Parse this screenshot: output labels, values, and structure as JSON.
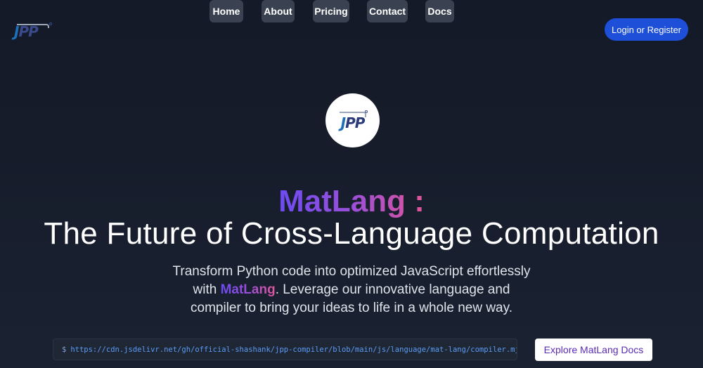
{
  "logo": {
    "part1": "J",
    "part2": "PP"
  },
  "nav": {
    "items": [
      {
        "label": "Home"
      },
      {
        "label": "About"
      },
      {
        "label": "Pricing"
      },
      {
        "label": "Contact"
      },
      {
        "label": "Docs"
      }
    ]
  },
  "header": {
    "login_label": "Login or Register"
  },
  "hero": {
    "brand": "MatLang :",
    "title": "The Future of Cross-Language Computation",
    "description": {
      "before": "Transform Python code into optimized JavaScript effortlessly with ",
      "highlight": "MatLang",
      "after": ". Leverage our innovative language and compiler to bring your ideas to life in a whole new way."
    },
    "cdn": {
      "prompt": "$",
      "url": "https://cdn.jsdelivr.net/gh/official-shashank/jpp-compiler/blob/main/js/language/mat-lang/compiler.mjs"
    },
    "docs_button": "Explore MatLang Docs"
  },
  "colors": {
    "accent_blue": "#1d4fd8",
    "gradient_start": "#6c4bf2",
    "gradient_end": "#e0559a",
    "background": "#161c2a"
  }
}
